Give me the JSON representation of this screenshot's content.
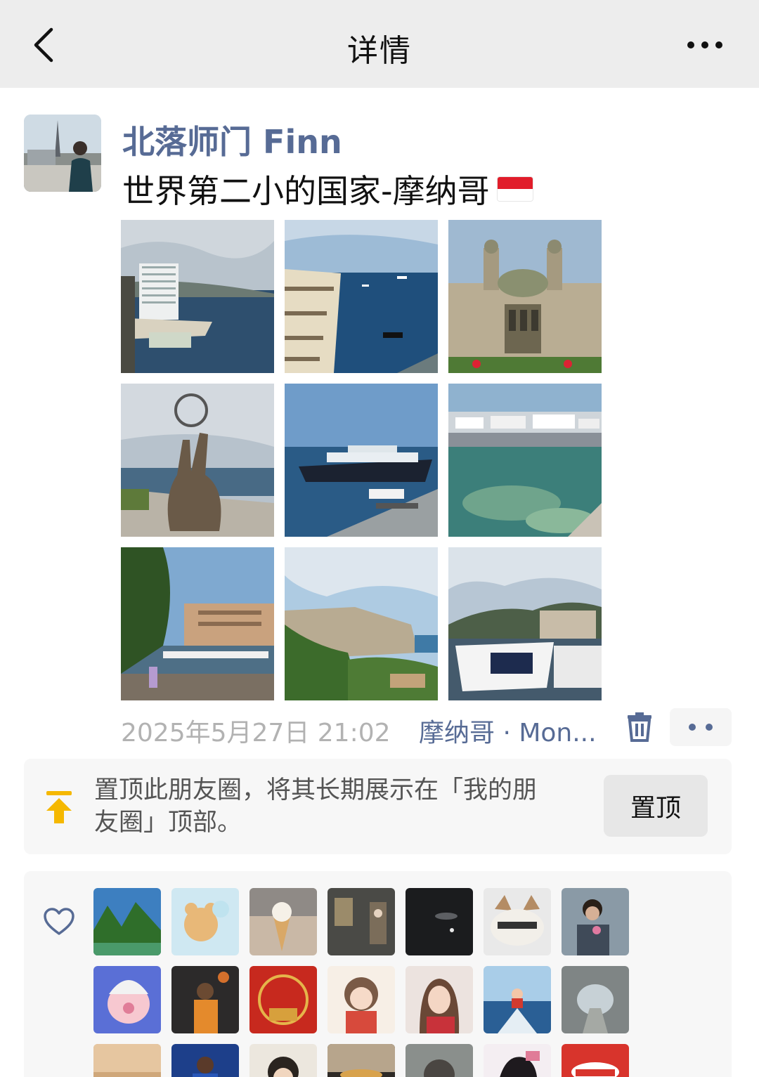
{
  "navbar": {
    "title": "详情",
    "back_icon": "chevron-left-icon",
    "more_icon": "more-dots-icon"
  },
  "post": {
    "author": "北落师门 Finn",
    "text": "世界第二小的国家-摩纳哥",
    "flag_icon": "monaco-flag-icon",
    "photos": [
      {
        "name": "photo-highrise-harbor"
      },
      {
        "name": "photo-balcony-sea"
      },
      {
        "name": "photo-casino-building"
      },
      {
        "name": "photo-hand-sculpture"
      },
      {
        "name": "photo-cruise-ship"
      },
      {
        "name": "photo-marina-yachts"
      },
      {
        "name": "photo-port-view"
      },
      {
        "name": "photo-rock-cliff"
      },
      {
        "name": "photo-boat-harbor"
      }
    ],
    "timestamp": "2025年5月27日 21:02",
    "location": "摩纳哥 · Mon...",
    "delete_icon": "trash-icon",
    "comment_icon": "comment-dots-icon"
  },
  "pin": {
    "text": "置顶此朋友圈，将其长期展示在「我的朋友圈」顶部。",
    "button_label": "置顶",
    "icon": "pin-top-icon",
    "icon_color": "#f5b800"
  },
  "likes": {
    "icon": "heart-outline-icon",
    "avatars": [
      "liker-1",
      "liker-2",
      "liker-3",
      "liker-4",
      "liker-5",
      "liker-6",
      "liker-7",
      "liker-8",
      "liker-9",
      "liker-10",
      "liker-11",
      "liker-12",
      "liker-13",
      "liker-14",
      "liker-15",
      "liker-16",
      "liker-17",
      "liker-18",
      "liker-19",
      "liker-20",
      "liker-21"
    ]
  },
  "colors": {
    "link": "#576b95",
    "navbar_bg": "#ededed",
    "card_bg": "#f7f7f7",
    "muted": "#b2b2b2"
  }
}
